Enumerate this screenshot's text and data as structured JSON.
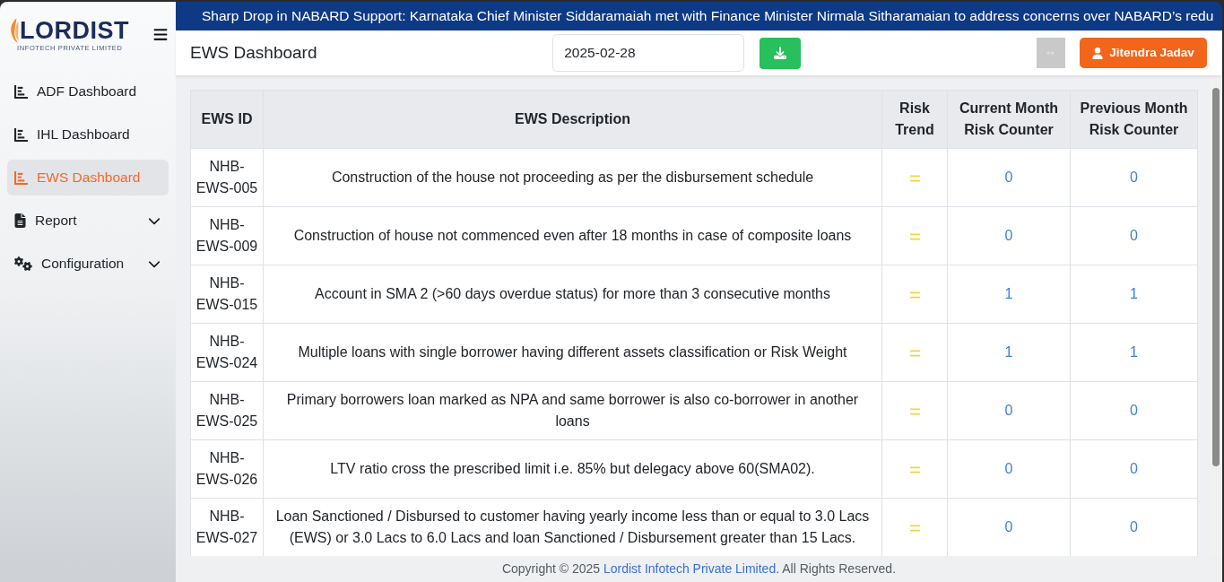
{
  "sidebar": {
    "logo": {
      "name": "LORDIST",
      "tagline": "INFOTECH PRIVATE LIMITED"
    },
    "items": [
      {
        "label": "ADF Dashboard",
        "kind": "link",
        "selected": false
      },
      {
        "label": "IHL Dashboard",
        "kind": "link",
        "selected": false
      },
      {
        "label": "EWS Dashboard",
        "kind": "link",
        "selected": true
      },
      {
        "label": "Report",
        "kind": "group",
        "selected": false,
        "expanded": false
      },
      {
        "label": "Configuration",
        "kind": "group",
        "selected": false,
        "expanded": false
      }
    ]
  },
  "ticker": {
    "text": "Sharp Drop in NABARD Support: Karnataka Chief Minister Siddaramaiah met with Finance Minister Nirmala Sitharamaian to address concerns over NABARD’s redu"
  },
  "header": {
    "title": "EWS Dashboard",
    "date_field": {
      "value": "2025-02-28"
    },
    "user_button": {
      "label": "Jitendra Jadav"
    }
  },
  "table": {
    "columns": [
      "EWS ID",
      "EWS Description",
      "Risk Trend",
      "Current Month Risk Counter",
      "Previous Month Risk Counter"
    ],
    "rows": [
      {
        "id": "NHB-EWS-005",
        "description": "Construction of the house not proceeding as per the disbursement schedule",
        "trend": {
          "kind": "equal"
        },
        "current": "0",
        "previous": "0"
      },
      {
        "id": "NHB-EWS-009",
        "description": "Construction of house not commenced even after 18 months in case of composite loans",
        "trend": {
          "kind": "equal"
        },
        "current": "0",
        "previous": "0"
      },
      {
        "id": "NHB-EWS-015",
        "description": "Account in SMA 2 (>60 days overdue status) for more than 3 consecutive months",
        "trend": {
          "kind": "equal"
        },
        "current": "1",
        "previous": "1"
      },
      {
        "id": "NHB-EWS-024",
        "description": "Multiple loans with single borrower having different assets classification or Risk Weight",
        "trend": {
          "kind": "equal"
        },
        "current": "1",
        "previous": "1"
      },
      {
        "id": "NHB-EWS-025",
        "description": "Primary borrowers loan marked as NPA and same borrower is also co-borrower in another loans",
        "trend": {
          "kind": "equal"
        },
        "current": "0",
        "previous": "0"
      },
      {
        "id": "NHB-EWS-026",
        "description": "LTV ratio cross the prescribed limit i.e. 85% but delegacy above 60(SMA02).",
        "trend": {
          "kind": "equal"
        },
        "current": "0",
        "previous": "0"
      },
      {
        "id": "NHB-EWS-027",
        "description": "Loan Sanctioned / Disbursed to customer having yearly income less than or equal to 3.0 Lacs (EWS) or 3.0 Lacs to 6.0 Lacs and loan Sanctioned / Disbursement greater than 15 Lacs.",
        "trend": {
          "kind": "equal"
        },
        "current": "0",
        "previous": "0"
      }
    ]
  },
  "footer": {
    "text_before": "Copyright © 2025",
    "link": "Lordist Infotech Private Limited",
    "text_after": ". All Rights Reserved."
  }
}
